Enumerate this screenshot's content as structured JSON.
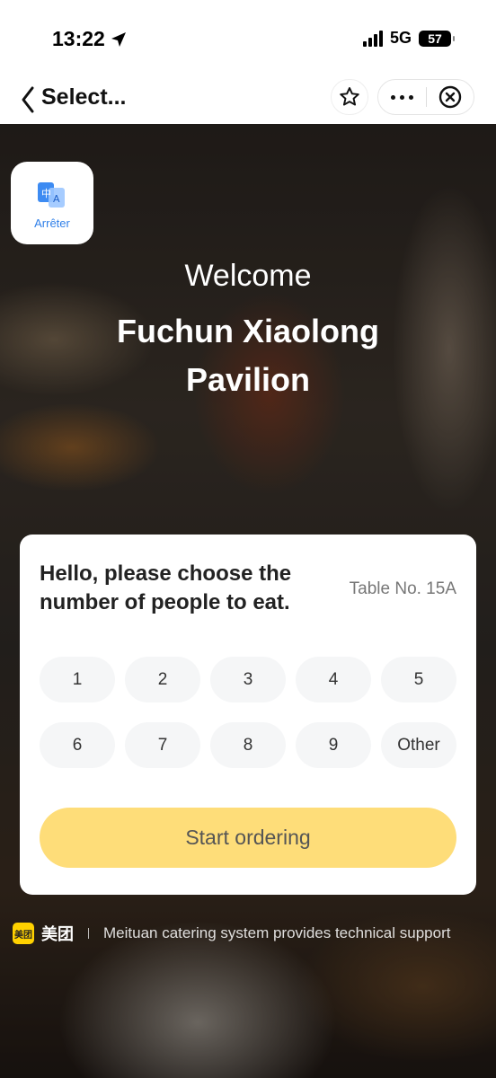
{
  "status_bar": {
    "time": "13:22",
    "network": "5G",
    "battery": "57"
  },
  "nav": {
    "title": "Select..."
  },
  "app_badge": {
    "label": "Arrêter"
  },
  "hero": {
    "welcome": "Welcome",
    "store_name": "Fuchun Xiaolong Pavilion"
  },
  "card": {
    "prompt": "Hello, please choose the number of people to eat.",
    "table_no": "Table No. 15A",
    "people_options": [
      "1",
      "2",
      "3",
      "4",
      "5",
      "6",
      "7",
      "8",
      "9",
      "Other"
    ],
    "start_label": "Start ordering"
  },
  "footer": {
    "logo_text": "美团",
    "brand": "美团",
    "support": "Meituan catering system provides technical support"
  },
  "colors": {
    "start_button": "#fedd79",
    "badge_label": "#2f7fe8",
    "meituan_yellow": "#ffd100"
  }
}
